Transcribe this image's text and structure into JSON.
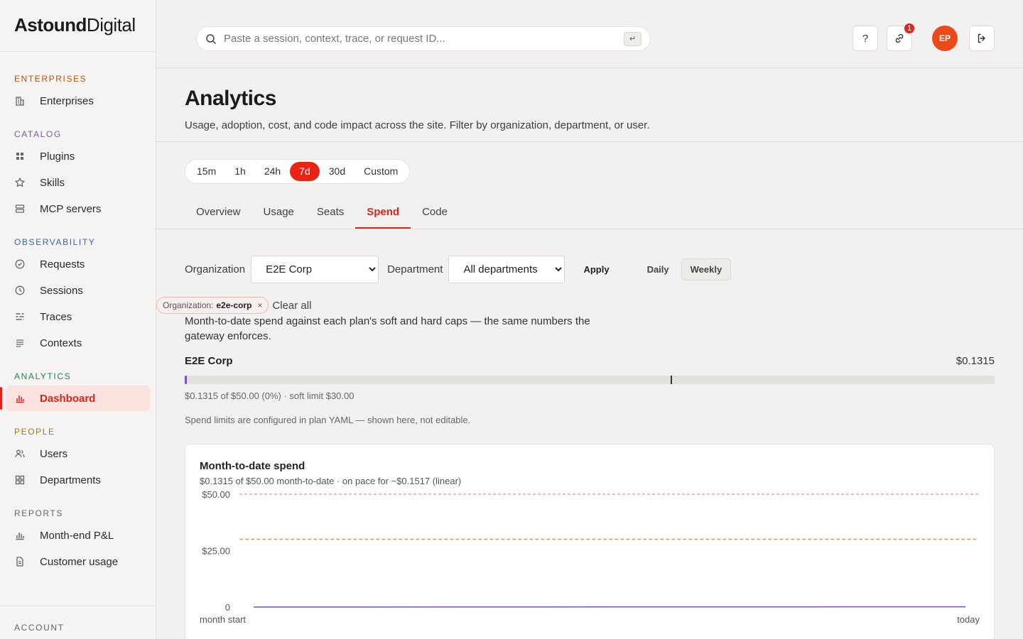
{
  "brand": {
    "bold": "Astound",
    "light": "Digital"
  },
  "sidebar": {
    "sections": [
      {
        "label": "ENTERPRISES",
        "color": "#b5560f",
        "items": [
          {
            "label": "Enterprises",
            "icon": "building-icon"
          }
        ]
      },
      {
        "label": "CATALOG",
        "color": "#7a5aa8",
        "items": [
          {
            "label": "Plugins",
            "icon": "grid-icon"
          },
          {
            "label": "Skills",
            "icon": "star-icon"
          },
          {
            "label": "MCP servers",
            "icon": "server-icon"
          }
        ]
      },
      {
        "label": "OBSERVABILITY",
        "color": "#3f63a8",
        "items": [
          {
            "label": "Requests",
            "icon": "check-circle-icon"
          },
          {
            "label": "Sessions",
            "icon": "clock-icon"
          },
          {
            "label": "Traces",
            "icon": "traces-icon"
          },
          {
            "label": "Contexts",
            "icon": "lines-icon"
          }
        ]
      },
      {
        "label": "ANALYTICS",
        "color": "#1f8a5a",
        "items": [
          {
            "label": "Dashboard",
            "icon": "bar-chart-icon",
            "active": true
          }
        ]
      },
      {
        "label": "PEOPLE",
        "color": "#a07a10",
        "items": [
          {
            "label": "Users",
            "icon": "users-icon"
          },
          {
            "label": "Departments",
            "icon": "departments-icon"
          }
        ]
      },
      {
        "label": "REPORTS",
        "color": "#666666",
        "items": [
          {
            "label": "Month-end P&L",
            "icon": "bar-chart-icon"
          },
          {
            "label": "Customer usage",
            "icon": "document-icon"
          }
        ]
      }
    ],
    "bottom_section": "ACCOUNT"
  },
  "topbar": {
    "search_placeholder": "Paste a session, context, trace, or request ID...",
    "enter_key": "↵",
    "help_label": "?",
    "link_badge": "1",
    "avatar_initials": "EP"
  },
  "header": {
    "title": "Analytics",
    "subtitle": "Usage, adoption, cost, and code impact across the site. Filter by organization, department, or user."
  },
  "ranges": [
    {
      "label": "15m"
    },
    {
      "label": "1h"
    },
    {
      "label": "24h"
    },
    {
      "label": "7d",
      "active": true
    },
    {
      "label": "30d"
    },
    {
      "label": "Custom"
    }
  ],
  "tabs": [
    {
      "label": "Overview"
    },
    {
      "label": "Usage"
    },
    {
      "label": "Seats"
    },
    {
      "label": "Spend",
      "active": true
    },
    {
      "label": "Code"
    }
  ],
  "filters": {
    "org_label": "Organization",
    "org_value": "E2E Corp",
    "dept_label": "Department",
    "dept_value": "All departments",
    "apply": "Apply",
    "daily": "Daily",
    "weekly": "Weekly",
    "chip_key": "Organization:",
    "chip_value": "e2e-corp",
    "chip_remove": "×",
    "clear_all": "Clear all"
  },
  "spend": {
    "description": "Month-to-date spend against each plan's soft and hard caps — the same numbers the gateway enforces.",
    "org_name": "E2E Corp",
    "org_value": "$0.1315",
    "fraction_used": 0.00263,
    "soft_limit_fraction": 0.6,
    "meta": "$0.1315 of $50.00 (0%) · soft limit $30.00",
    "note": "Spend limits are configured in plan YAML — shown here, not editable."
  },
  "chart": {
    "title": "Month-to-date spend",
    "subtitle": "$0.1315 of $50.00 month-to-date · on pace for ~$0.1517 (linear)"
  },
  "chart_data": {
    "type": "line",
    "y_ticks": [
      "$50.00",
      "$25.00",
      "0"
    ],
    "x_ticks": [
      "month start",
      "today"
    ],
    "ylim": [
      0,
      50
    ],
    "soft_cap": 30,
    "hard_cap": 50,
    "series": [
      {
        "values": [
          0,
          0.02,
          0.04,
          0.06,
          0.08,
          0.1,
          0.1315
        ],
        "color": "#7b4fc8"
      }
    ],
    "cap_colors": {
      "soft": "#e0a020",
      "hard": "#e07a6a"
    }
  }
}
